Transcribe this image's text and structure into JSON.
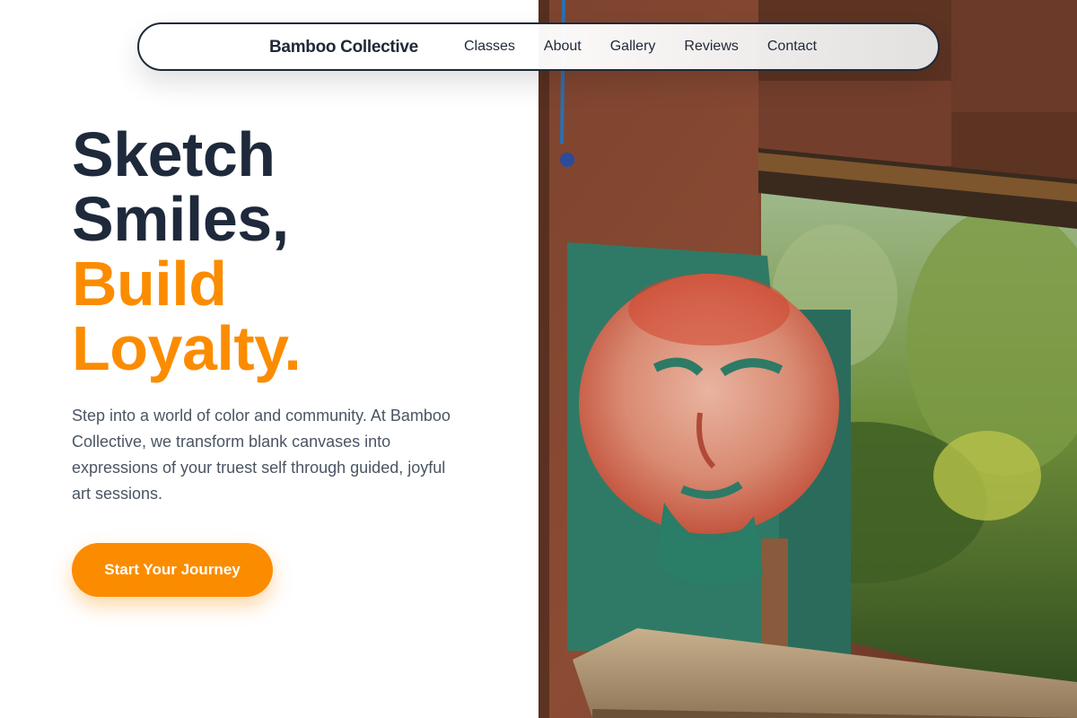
{
  "nav": {
    "brand": "Bamboo Collective",
    "links": [
      {
        "label": "Classes"
      },
      {
        "label": "About"
      },
      {
        "label": "Gallery"
      },
      {
        "label": "Reviews"
      },
      {
        "label": "Contact"
      }
    ]
  },
  "hero": {
    "headline_line1": "Sketch",
    "headline_line2": "Smiles,",
    "headline_line3": "Build",
    "headline_line4": "Loyalty.",
    "intro": "Step into a world of color and community. At Bamboo Collective, we transform blank canvases into expressions of your truest self through guided, joyful art sessions.",
    "cta_label": "Start Your Journey"
  },
  "image": {
    "subject": "painted face artwork mounted in a rusted metal window frame overlooking trees"
  },
  "colors": {
    "accent": "#fb8c00",
    "heading": "#1e293b",
    "body_text": "#4b5563",
    "nav_border": "#1f2937"
  }
}
